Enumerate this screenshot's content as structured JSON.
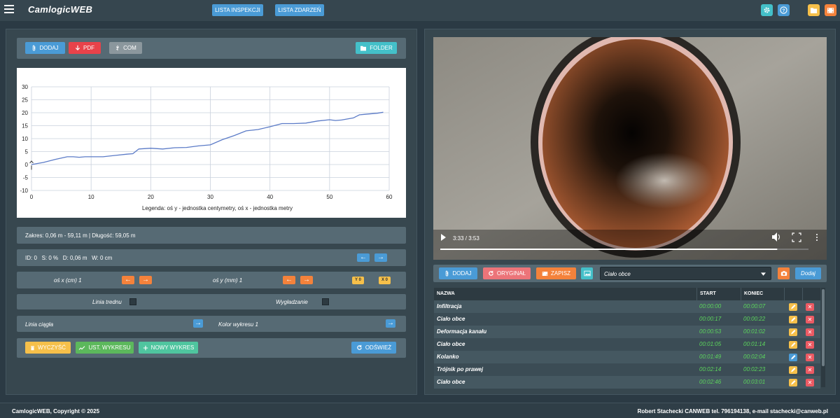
{
  "app": {
    "brand": "CamlogicWEB",
    "nav": [
      "LISTA INSPEKCJI",
      "LISTA ZDARZEŃ"
    ]
  },
  "left_toolbar": {
    "add": "DODAJ",
    "pdf": "PDF",
    "com": "COM",
    "folder": "FOLDER"
  },
  "chart_data": {
    "type": "line",
    "title": "",
    "xlabel": "",
    "ylabel": "",
    "legend_text": "Legenda: oś y - jednostka centymetry, oś x - jednostka metry",
    "xlim": [
      0,
      60
    ],
    "ylim": [
      -10,
      30
    ],
    "xticks": [
      "0",
      "10",
      "20",
      "30",
      "40",
      "50",
      "60"
    ],
    "yticks": [
      "-10",
      "-5",
      "0",
      "5",
      "10",
      "15",
      "20",
      "25",
      "30"
    ],
    "grid": true,
    "color": "#5b7bc7",
    "x": [
      0,
      2,
      4,
      6,
      7,
      8,
      9,
      10,
      12,
      14,
      16,
      17,
      18,
      20,
      22,
      24,
      26,
      28,
      30,
      32,
      34,
      36,
      38,
      40,
      42,
      44,
      46,
      48,
      50,
      51,
      52,
      54,
      55,
      56,
      58,
      59
    ],
    "y": [
      0,
      0.8,
      2.0,
      3.0,
      3.0,
      2.8,
      3.0,
      3.0,
      3.0,
      3.5,
      4.0,
      4.2,
      6.0,
      6.3,
      6.0,
      6.5,
      6.6,
      7.2,
      7.6,
      9.6,
      11.2,
      13.0,
      13.5,
      14.6,
      15.8,
      15.8,
      16.0,
      16.8,
      17.3,
      17.0,
      17.2,
      18.0,
      19.2,
      19.4,
      19.8,
      20.2
    ]
  },
  "info": {
    "range": "Zakres: 0,06 m - 59,11 m | Długość: 59,05 m",
    "stats": "ID: 0   S: 0 %   D: 0,06 m   W: 0 cm"
  },
  "axis_row": {
    "x_label": "oś x (cm) 1",
    "y_label": "oś y (mm) 1",
    "y0": "Y 0",
    "x0": "X 0"
  },
  "trend_row": {
    "trend_label": "Linia trednu",
    "smooth_label": "Wygładzanie"
  },
  "line_row": {
    "solid_label": "Linia ciągła",
    "color_label": "Kolor wykresu 1"
  },
  "actions": {
    "clear": "WYCZYŚĆ",
    "settings": "UST. WYKRESU",
    "new_chart": "NOWY WYKRES",
    "refresh": "ODŚWIEŻ"
  },
  "video": {
    "time": "3:33 / 3:53",
    "progress": 0.915
  },
  "video_toolbar": {
    "add": "DODAJ",
    "original": "ORYGINAŁ",
    "save": "ZAPISZ",
    "select_value": "Ciało obce",
    "add_small": "Dodaj"
  },
  "events": {
    "headers": [
      "NAZWA",
      "START",
      "KONIEC"
    ],
    "rows": [
      {
        "name": "Infiltracja",
        "start": "00:00:00",
        "end": "00:00:07",
        "edit_color": "#f6c04a"
      },
      {
        "name": "Ciało obce",
        "start": "00:00:17",
        "end": "00:00:22",
        "edit_color": "#f6c04a"
      },
      {
        "name": "Deformacja kanału",
        "start": "00:00:53",
        "end": "00:01:02",
        "edit_color": "#f6c04a"
      },
      {
        "name": "Ciało obce",
        "start": "00:01:05",
        "end": "00:01:14",
        "edit_color": "#f6c04a"
      },
      {
        "name": "Kolanko",
        "start": "00:01:49",
        "end": "00:02:04",
        "edit_color": "#4a9bd6"
      },
      {
        "name": "Trójnik po prawej",
        "start": "00:02:14",
        "end": "00:02:23",
        "edit_color": "#f6c04a"
      },
      {
        "name": "Ciało obce",
        "start": "00:02:46",
        "end": "00:03:01",
        "edit_color": "#f6c04a"
      }
    ]
  },
  "footer": {
    "copyright": "CamlogicWEB, Copyright © 2025",
    "contact": "Robert Stachecki CANWEB tel. 796194138, e-mail stachecki@canweb.pl"
  }
}
